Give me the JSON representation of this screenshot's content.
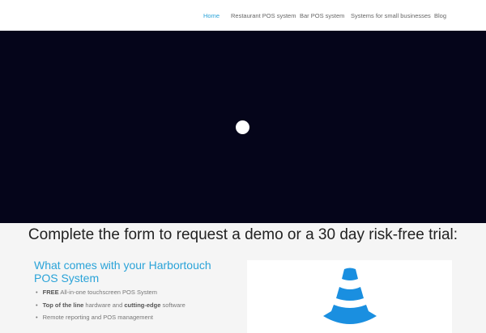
{
  "nav": {
    "items": [
      "Home",
      "Restaurant POS system",
      "Bar POS system",
      "Systems for small businesses",
      "Blog"
    ],
    "active": "Home"
  },
  "headline": "Complete the form to request a demo or a 30 day risk-free trial:",
  "features": {
    "title": "What comes with your Harbortouch POS System",
    "items": [
      [
        {
          "t": "FREE",
          "b": true
        },
        {
          "t": " All-in-one touchscreen POS System"
        }
      ],
      [
        {
          "t": "Top of the line",
          "b": true
        },
        {
          "t": " hardware and "
        },
        {
          "t": "cutting-edge",
          "b": true
        },
        {
          "t": " software"
        }
      ],
      [
        {
          "t": "Remote reporting and POS management"
        }
      ]
    ]
  },
  "colors": {
    "accent": "#2aa3d8",
    "video_bg": "#05051a",
    "cone": "#1a8fe0"
  }
}
